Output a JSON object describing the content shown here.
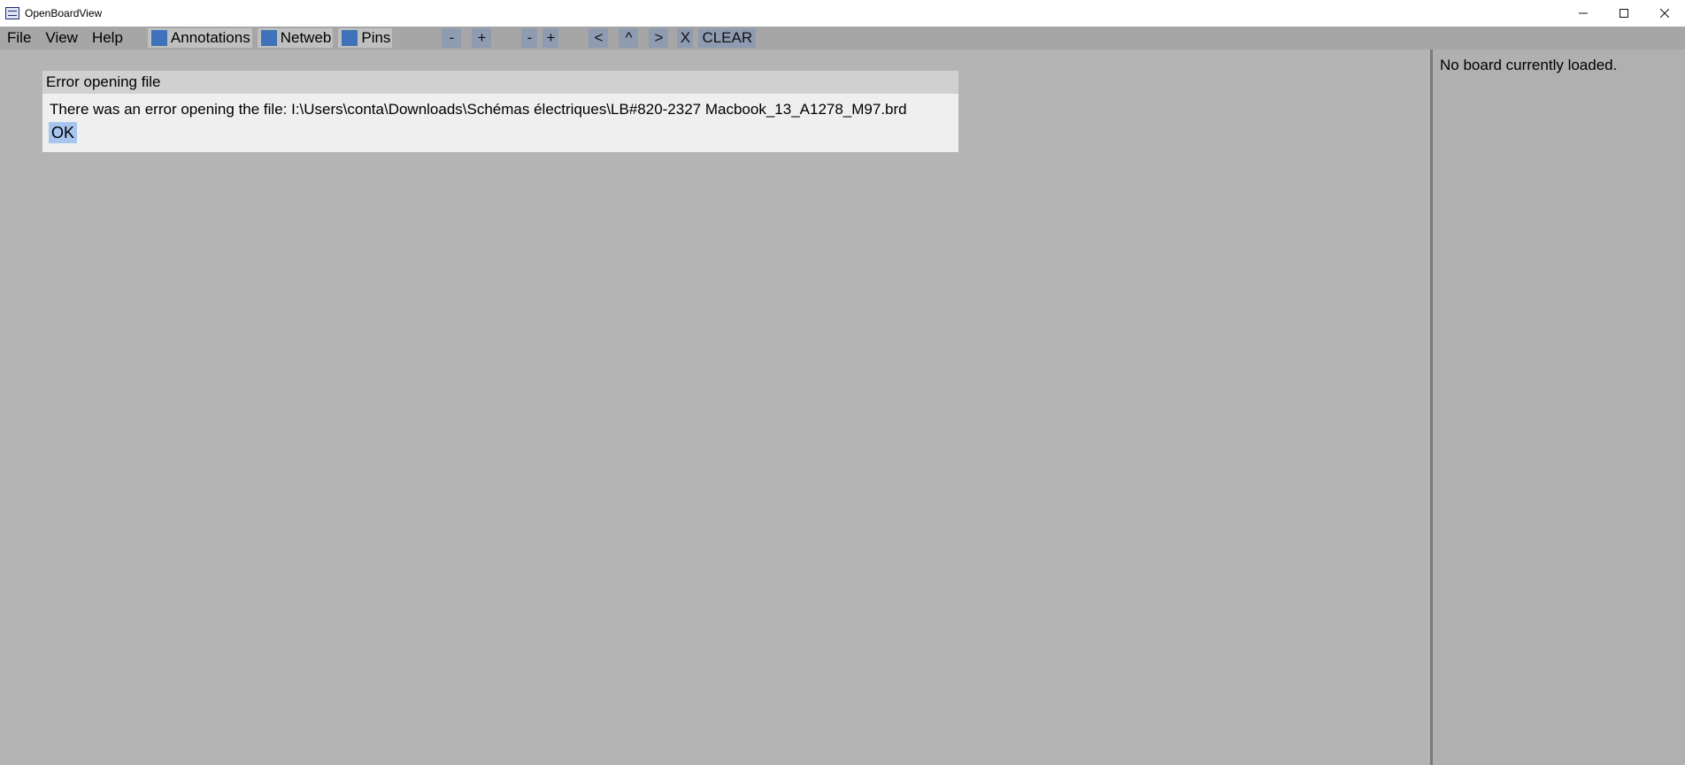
{
  "window": {
    "title": "OpenBoardView",
    "controls": [
      "minimize",
      "maximize",
      "close"
    ]
  },
  "menubar": {
    "menus": [
      "File",
      "View",
      "Help"
    ],
    "toggles": [
      {
        "label": "Annotations",
        "checked": true
      },
      {
        "label": "Netweb",
        "checked": true
      },
      {
        "label": "Pins",
        "checked": true
      }
    ],
    "zoom1": {
      "minus": "-",
      "plus": "+"
    },
    "zoom2": {
      "minus": "-",
      "plus": "+"
    },
    "nav": {
      "left": "<",
      "up": "^",
      "right": ">",
      "x": "X",
      "clear": "CLEAR"
    }
  },
  "dialog": {
    "title": "Error opening file",
    "message": "There was an error opening the file: I:\\Users\\conta\\Downloads\\Schémas électriques\\LB#820-2327 Macbook_13_A1278_M97.brd",
    "ok_label": "OK"
  },
  "side_panel": {
    "message": "No board currently loaded."
  },
  "colors": {
    "background": "#b4b4b4",
    "menubar": "#a6a6a6",
    "button": "#8f9bb0",
    "checkbox": "#3f72b8",
    "ok_button": "#a7c5ee",
    "dialog_title": "#d0d0d0",
    "dialog_body": "#efefef"
  }
}
